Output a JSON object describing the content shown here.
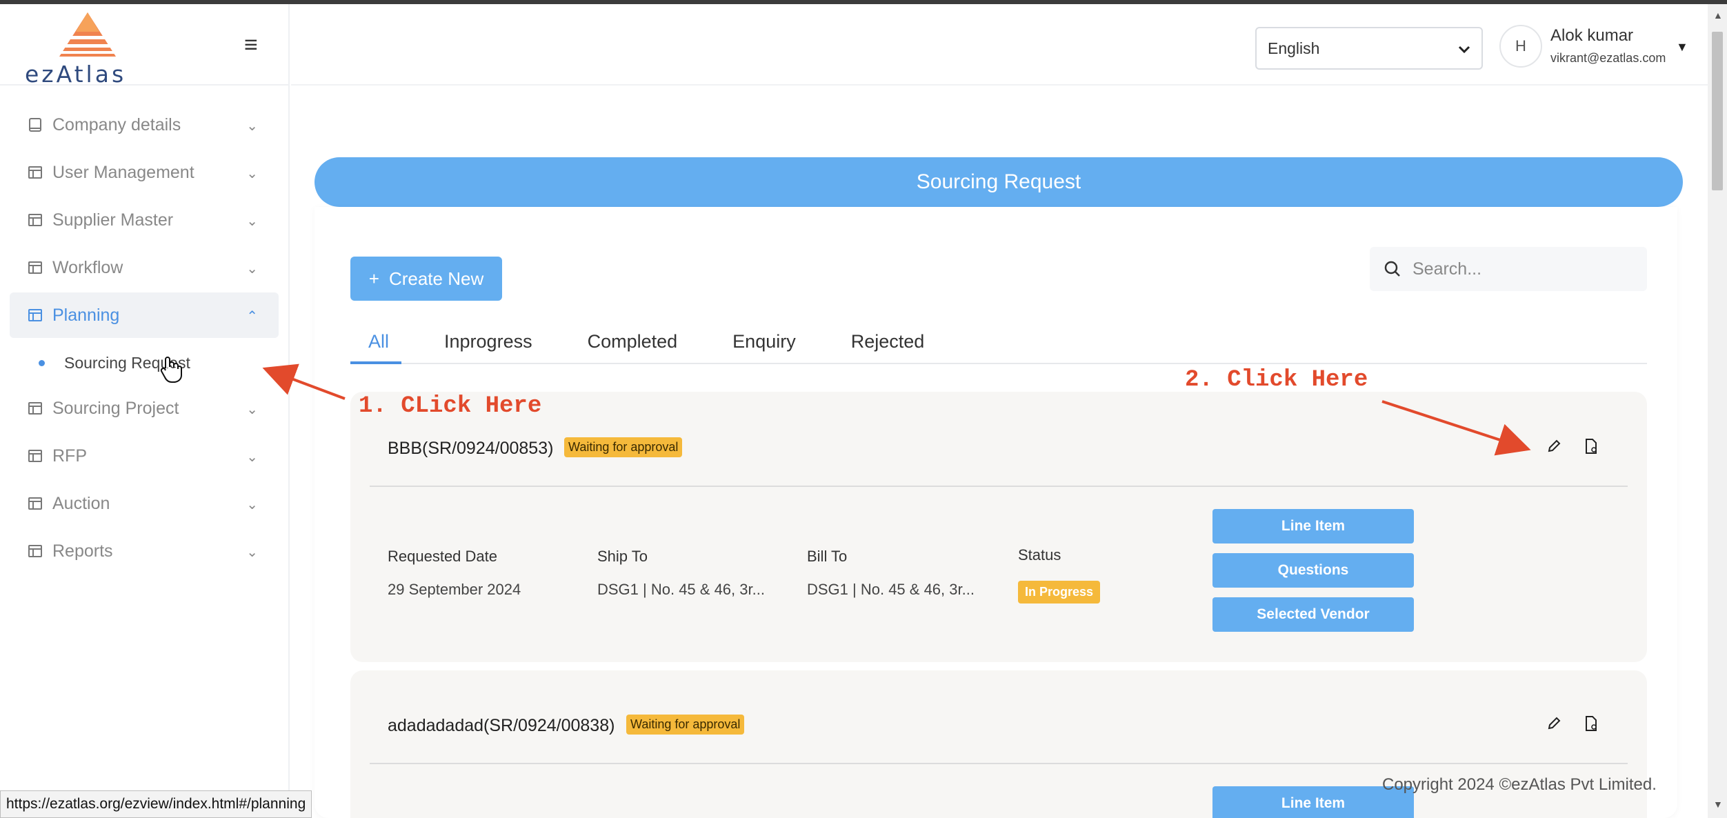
{
  "brand": {
    "logo_text": "ezAtlas"
  },
  "sidebar": {
    "items": [
      {
        "label": "Company details",
        "icon": "book-icon",
        "expanded": false
      },
      {
        "label": "User Management",
        "icon": "table-icon",
        "expanded": false
      },
      {
        "label": "Supplier Master",
        "icon": "table-icon",
        "expanded": false
      },
      {
        "label": "Workflow",
        "icon": "table-icon",
        "expanded": false
      },
      {
        "label": "Planning",
        "icon": "table-icon",
        "expanded": true,
        "active": true
      },
      {
        "label": "Sourcing Project",
        "icon": "table-icon",
        "expanded": false
      },
      {
        "label": "RFP",
        "icon": "table-icon",
        "expanded": false
      },
      {
        "label": "Auction",
        "icon": "table-icon",
        "expanded": false
      },
      {
        "label": "Reports",
        "icon": "table-icon",
        "expanded": false
      }
    ],
    "submenu": {
      "label": "Sourcing Request"
    }
  },
  "header": {
    "language": "English",
    "avatar_text": "H",
    "user_name": "Alok kumar",
    "user_email": "vikrant@ezatlas.com"
  },
  "page": {
    "title": "Sourcing Request",
    "create_label": "Create New",
    "create_plus": "+",
    "search_placeholder": "Search...",
    "tabs": [
      "All",
      "Inprogress",
      "Completed",
      "Enquiry",
      "Rejected"
    ],
    "active_tab": "All"
  },
  "cards": [
    {
      "title": "BBB(SR/0924/00853)",
      "badge": "Waiting for approval",
      "fields": [
        {
          "label": "Requested Date",
          "value": "29 September 2024"
        },
        {
          "label": "Ship To",
          "value": "DSG1 | No. 45 & 46, 3r..."
        },
        {
          "label": "Bill To",
          "value": "DSG1 | No. 45 & 46, 3r..."
        },
        {
          "label": "Status",
          "value": "In Progress"
        }
      ],
      "actions": [
        "Line Item",
        "Questions",
        "Selected Vendor"
      ]
    },
    {
      "title": "adadadadad(SR/0924/00838)",
      "badge": "Waiting for approval",
      "actions": [
        "Line Item"
      ]
    }
  ],
  "annotations": {
    "step1": "1. CLick Here",
    "step2": "2. Click Here"
  },
  "footer": {
    "copyright": "Copyright 2024 ©ezAtlas Pvt Limited.",
    "status_url": "https://ezatlas.org/ezview/index.html#/planning"
  },
  "colors": {
    "accent": "#64aef0",
    "active_text": "#4a90e2",
    "badge": "#f5b93b",
    "annotation": "#e24a2c"
  }
}
